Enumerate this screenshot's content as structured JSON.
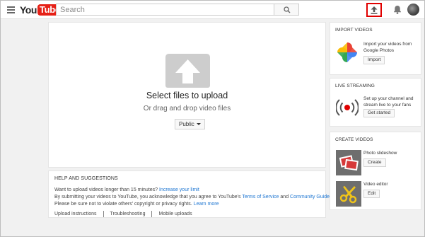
{
  "header": {
    "logo_you": "You",
    "logo_tube": "Tube",
    "search_placeholder": "Search"
  },
  "upload": {
    "title": "Select files to upload",
    "subtitle": "Or drag and drop video files",
    "privacy_value": "Public"
  },
  "help": {
    "title": "HELP AND SUGGESTIONS",
    "line1_text": "Want to upload videos longer than 15 minutes?",
    "line1_link": "Increase your limit",
    "line2_text": "By submitting your videos to YouTube, you acknowledge that you agree to YouTube's",
    "line2_link1": "Terms of Service",
    "line2_and": "and",
    "line2_link2": "Community Guidelines.",
    "line3_text": "Please be sure not to violate others' copyright or privacy rights.",
    "line3_link": "Learn more",
    "links": [
      "Upload instructions",
      "Troubleshooting",
      "Mobile uploads"
    ]
  },
  "import_videos": {
    "title": "IMPORT VIDEOS",
    "description": "Import your videos from Google Photos",
    "button": "Import"
  },
  "live_streaming": {
    "title": "LIVE STREAMING",
    "description": "Set up your channel and stream live to your fans",
    "button": "Get started"
  },
  "create_videos": {
    "title": "CREATE VIDEOS",
    "slideshow_label": "Photo slideshow",
    "slideshow_button": "Create",
    "editor_label": "Video editor",
    "editor_button": "Edit"
  },
  "colors": {
    "brand_red": "#e62117",
    "link_blue": "#1b74d1",
    "upload_highlight": "#e00000"
  }
}
